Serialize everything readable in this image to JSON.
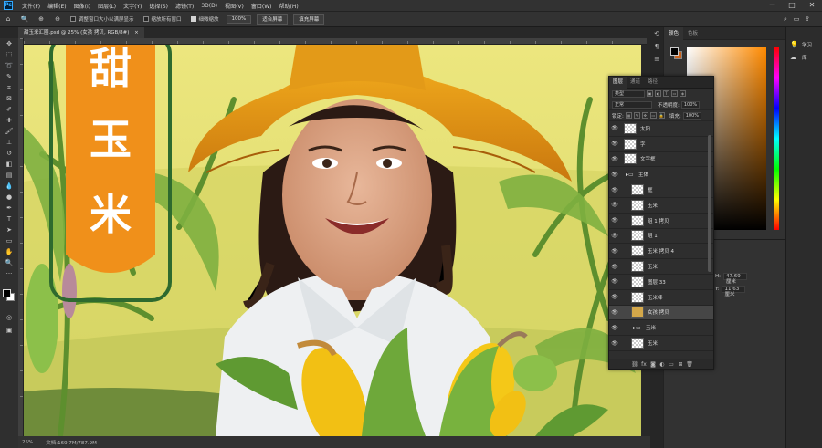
{
  "menubar": {
    "logo": "Ps",
    "items": [
      "文件(F)",
      "编辑(E)",
      "图像(I)",
      "图层(L)",
      "文字(Y)",
      "选择(S)",
      "滤镜(T)",
      "3D(D)",
      "视图(V)",
      "窗口(W)",
      "帮助(H)"
    ]
  },
  "options": {
    "resize_windows": "调整窗口大小以满屏显示",
    "zoom_all": "缩放所有窗口",
    "scrubby_zoom": "细微缩放",
    "zoom_value": "100%",
    "fit_screen": "适合屏幕",
    "fill_screen": "填充屏幕"
  },
  "document": {
    "tab_title": "甜玉米汇圈.psd @ 25% (女孩 拷贝, RGB/8#)",
    "close": "×"
  },
  "status": {
    "zoom": "25%",
    "doc_size": "文档:169.7M/787.9M"
  },
  "artwork": {
    "title_chars": [
      "甜",
      "玉",
      "米"
    ]
  },
  "color_panel": {
    "tabs": [
      "颜色",
      "色板"
    ]
  },
  "properties": {
    "h_label": "H:",
    "h_value": "47.69 厘米",
    "y_label": "Y:",
    "y_value": "11.63 厘米"
  },
  "right_strip": {
    "items": [
      {
        "icon": "lightbulb-icon",
        "label": "学习"
      },
      {
        "icon": "library-icon",
        "label": "库"
      }
    ]
  },
  "layers_panel": {
    "tabs": [
      "图层",
      "通道",
      "路径"
    ],
    "filter_kind": "类型",
    "blend_mode": "正常",
    "opacity_label": "不透明度:",
    "opacity_value": "100%",
    "lock_label": "锁定:",
    "fill_label": "填充:",
    "fill_value": "100%",
    "layers": [
      {
        "name": "太阳",
        "type": "layer",
        "indent": 0
      },
      {
        "name": "字",
        "type": "layer",
        "indent": 0
      },
      {
        "name": "文字框",
        "type": "layer",
        "indent": 0
      },
      {
        "name": "主体",
        "type": "group",
        "indent": 0
      },
      {
        "name": "框",
        "type": "layer",
        "indent": 1
      },
      {
        "name": "玉米",
        "type": "layer",
        "indent": 1
      },
      {
        "name": "组 1 拷贝",
        "type": "layer",
        "indent": 1
      },
      {
        "name": "组 1",
        "type": "layer",
        "indent": 1
      },
      {
        "name": "玉米 拷贝 4",
        "type": "layer",
        "indent": 1
      },
      {
        "name": "玉米",
        "type": "layer",
        "indent": 1
      },
      {
        "name": "图层 33",
        "type": "layer",
        "indent": 1
      },
      {
        "name": "玉米棒",
        "type": "layer",
        "indent": 1
      },
      {
        "name": "女孩 拷贝",
        "type": "image",
        "indent": 1,
        "selected": true
      },
      {
        "name": "玉米",
        "type": "group",
        "indent": 1
      },
      {
        "name": "玉米",
        "type": "layer",
        "indent": 1
      }
    ]
  }
}
